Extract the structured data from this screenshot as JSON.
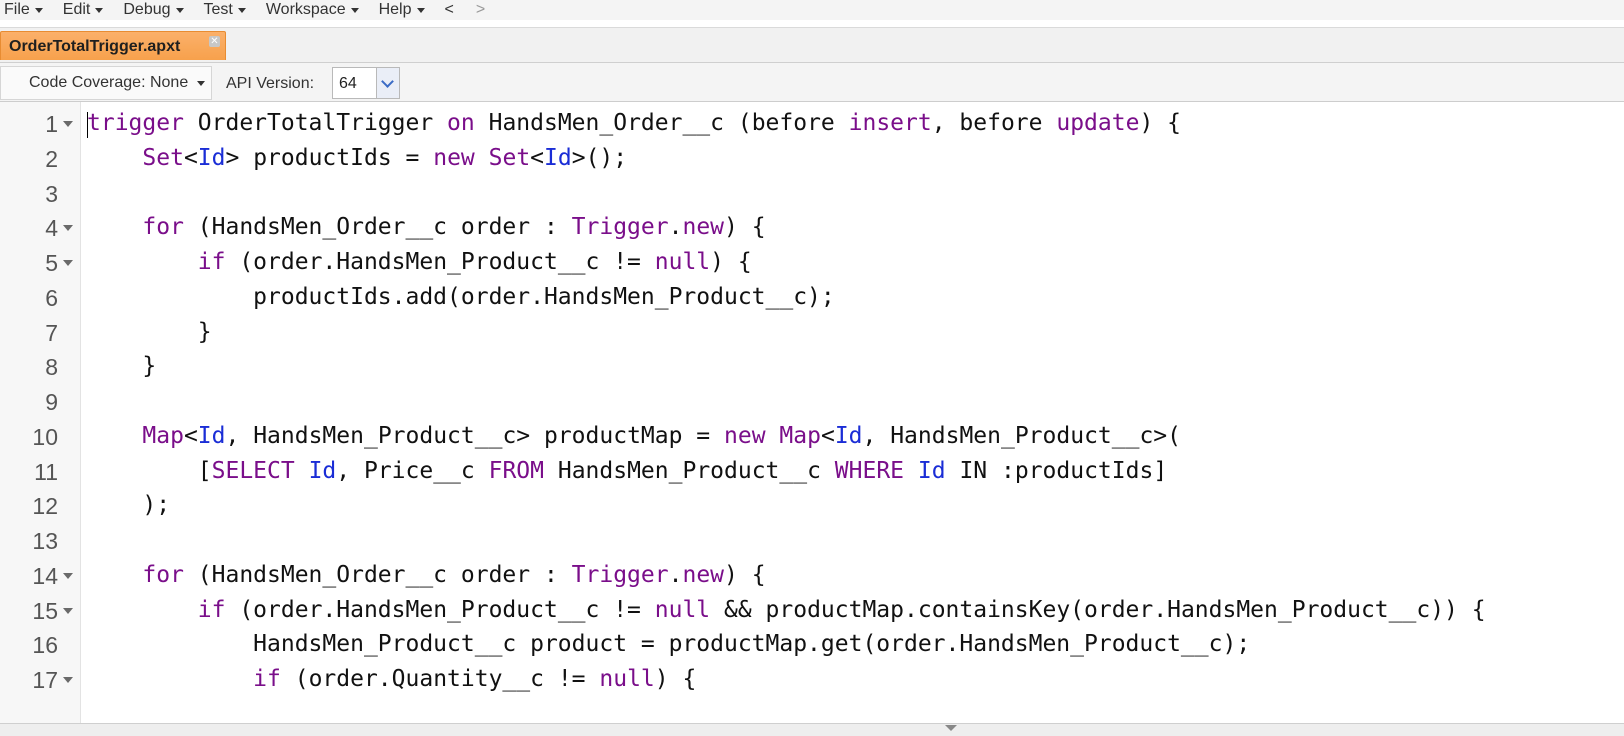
{
  "menu": {
    "items": [
      "File",
      "Edit",
      "Debug",
      "Test",
      "Workspace",
      "Help"
    ],
    "back": "<",
    "forward": ">"
  },
  "tab": {
    "title": "OrderTotalTrigger.apxt",
    "accent_color": "#f7a14c"
  },
  "toolbar": {
    "code_coverage": "Code Coverage: None",
    "api_label": "API Version:",
    "api_value": "64"
  },
  "editor": {
    "keyword_color": "#7a0e8a",
    "type_color": "#1a2dd6",
    "lines": [
      {
        "n": "1",
        "fold": true,
        "tokens": [
          [
            "kw",
            "trigger"
          ],
          [
            "p",
            " OrderTotalTrigger "
          ],
          [
            "kw",
            "on"
          ],
          [
            "p",
            " HandsMen_Order__c (before "
          ],
          [
            "kw",
            "insert"
          ],
          [
            "p",
            ", before "
          ],
          [
            "kw",
            "update"
          ],
          [
            "p",
            ") {"
          ]
        ]
      },
      {
        "n": "2",
        "fold": false,
        "tokens": [
          [
            "p",
            "    "
          ],
          [
            "kw",
            "Set"
          ],
          [
            "p",
            "<"
          ],
          [
            "ty",
            "Id"
          ],
          [
            "p",
            "> productIds = "
          ],
          [
            "kw",
            "new"
          ],
          [
            "p",
            " "
          ],
          [
            "kw",
            "Set"
          ],
          [
            "p",
            "<"
          ],
          [
            "ty",
            "Id"
          ],
          [
            "p",
            ">();"
          ]
        ]
      },
      {
        "n": "3",
        "fold": false,
        "tokens": []
      },
      {
        "n": "4",
        "fold": true,
        "tokens": [
          [
            "p",
            "    "
          ],
          [
            "kw",
            "for"
          ],
          [
            "p",
            " (HandsMen_Order__c order : "
          ],
          [
            "kw",
            "Trigger"
          ],
          [
            "p",
            "."
          ],
          [
            "kw",
            "new"
          ],
          [
            "p",
            ") {"
          ]
        ]
      },
      {
        "n": "5",
        "fold": true,
        "tokens": [
          [
            "p",
            "        "
          ],
          [
            "kw",
            "if"
          ],
          [
            "p",
            " (order.HandsMen_Product__c != "
          ],
          [
            "kw",
            "null"
          ],
          [
            "p",
            ") {"
          ]
        ]
      },
      {
        "n": "6",
        "fold": false,
        "tokens": [
          [
            "p",
            "            productIds.add(order.HandsMen_Product__c);"
          ]
        ]
      },
      {
        "n": "7",
        "fold": false,
        "tokens": [
          [
            "p",
            "        }"
          ]
        ]
      },
      {
        "n": "8",
        "fold": false,
        "tokens": [
          [
            "p",
            "    }"
          ]
        ]
      },
      {
        "n": "9",
        "fold": false,
        "tokens": []
      },
      {
        "n": "10",
        "fold": false,
        "tokens": [
          [
            "p",
            "    "
          ],
          [
            "kw",
            "Map"
          ],
          [
            "p",
            "<"
          ],
          [
            "ty",
            "Id"
          ],
          [
            "p",
            ", HandsMen_Product__c> productMap = "
          ],
          [
            "kw",
            "new"
          ],
          [
            "p",
            " "
          ],
          [
            "kw",
            "Map"
          ],
          [
            "p",
            "<"
          ],
          [
            "ty",
            "Id"
          ],
          [
            "p",
            ", HandsMen_Product__c>("
          ]
        ]
      },
      {
        "n": "11",
        "fold": false,
        "tokens": [
          [
            "p",
            "        ["
          ],
          [
            "kw",
            "SELECT"
          ],
          [
            "p",
            " "
          ],
          [
            "ty",
            "Id"
          ],
          [
            "p",
            ", Price__c "
          ],
          [
            "kw",
            "FROM"
          ],
          [
            "p",
            " HandsMen_Product__c "
          ],
          [
            "kw",
            "WHERE"
          ],
          [
            "p",
            " "
          ],
          [
            "ty",
            "Id"
          ],
          [
            "p",
            " IN :productIds]"
          ]
        ]
      },
      {
        "n": "12",
        "fold": false,
        "tokens": [
          [
            "p",
            "    );"
          ]
        ]
      },
      {
        "n": "13",
        "fold": false,
        "tokens": []
      },
      {
        "n": "14",
        "fold": true,
        "tokens": [
          [
            "p",
            "    "
          ],
          [
            "kw",
            "for"
          ],
          [
            "p",
            " (HandsMen_Order__c order : "
          ],
          [
            "kw",
            "Trigger"
          ],
          [
            "p",
            "."
          ],
          [
            "kw",
            "new"
          ],
          [
            "p",
            ") {"
          ]
        ]
      },
      {
        "n": "15",
        "fold": true,
        "tokens": [
          [
            "p",
            "        "
          ],
          [
            "kw",
            "if"
          ],
          [
            "p",
            " (order.HandsMen_Product__c != "
          ],
          [
            "kw",
            "null"
          ],
          [
            "p",
            " && productMap.containsKey(order.HandsMen_Product__c)) {"
          ]
        ]
      },
      {
        "n": "16",
        "fold": false,
        "tokens": [
          [
            "p",
            "            HandsMen_Product__c product = productMap.get(order.HandsMen_Product__c);"
          ]
        ]
      },
      {
        "n": "17",
        "fold": true,
        "tokens": [
          [
            "p",
            "            "
          ],
          [
            "kw",
            "if"
          ],
          [
            "p",
            " (order.Quantity__c != "
          ],
          [
            "kw",
            "null"
          ],
          [
            "p",
            ") {"
          ]
        ]
      }
    ]
  }
}
